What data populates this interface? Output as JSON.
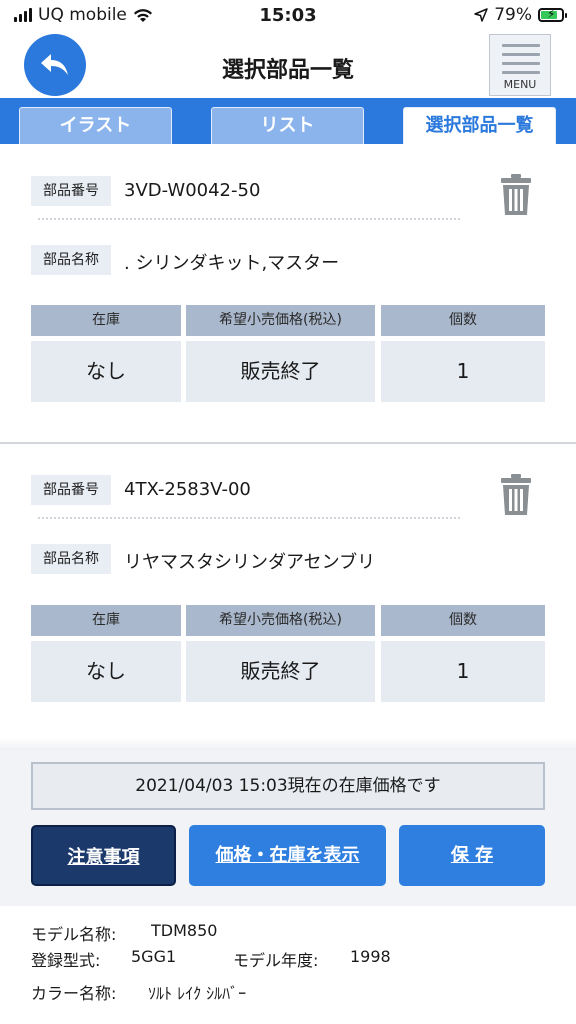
{
  "status_bar": {
    "carrier": "UQ mobile",
    "time": "15:03",
    "battery_percent": "79%",
    "battery_level": 0.79
  },
  "header": {
    "title": "選択部品一覧",
    "menu_label": "MENU"
  },
  "tabs": [
    {
      "label": "イラスト",
      "active": false
    },
    {
      "label": "リスト",
      "active": false
    },
    {
      "label": "選択部品一覧",
      "active": true
    }
  ],
  "labels": {
    "part_number": "部品番号",
    "part_name": "部品名称",
    "col_stock": "在庫",
    "col_price": "希望小売価格(税込)",
    "col_qty": "個数"
  },
  "parts": [
    {
      "part_number": "3VD-W0042-50",
      "part_name": ". シリンダキット,マスター",
      "stock": "なし",
      "price": "販売終了",
      "qty": "1"
    },
    {
      "part_number": "4TX-2583V-00",
      "part_name": "リヤマスタシリンダアセンブリ",
      "stock": "なし",
      "price": "販売終了",
      "qty": "1"
    }
  ],
  "notice": "2021/04/03 15:03現在の在庫価格です",
  "buttons": {
    "notes": "注意事項",
    "show_price": "価格・在庫を表示",
    "save": "保 存"
  },
  "model": {
    "name_label": "モデル名称:",
    "name_value": "TDM850",
    "type_label": "登録型式:",
    "type_value": "5GG1",
    "year_label": "モデル年度:",
    "year_value": "1998",
    "color_label": "カラー名称:",
    "color_value": "ｿﾙﾄ ﾚｲｸ ｼﾙﾊﾞｰ"
  },
  "colors": {
    "accent": "#2b79dc",
    "dark_button": "#1b3a6b"
  }
}
